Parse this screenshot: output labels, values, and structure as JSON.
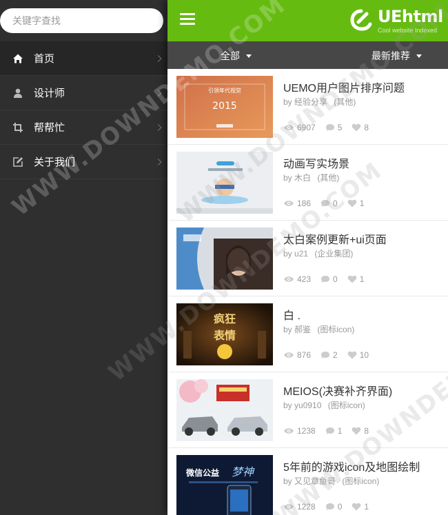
{
  "search": {
    "placeholder": "关键字查找"
  },
  "sidebar": {
    "items": [
      {
        "label": "首页",
        "icon": "home-icon",
        "active": true
      },
      {
        "label": "设计师",
        "icon": "user-icon",
        "active": false
      },
      {
        "label": "帮帮忙",
        "icon": "crop-icon",
        "active": false
      },
      {
        "label": "关于我们",
        "icon": "edit-icon",
        "active": false
      }
    ]
  },
  "header": {
    "logo_text": "UEhtml",
    "logo_sub": "Cool website Indexed",
    "brand_color": "#66bb11"
  },
  "filters": {
    "left": "全部",
    "right": "最新推荐"
  },
  "posts": [
    {
      "title": "UEMO用户图片排序问题",
      "by": "by",
      "author": "经验分享",
      "category": "(其他)",
      "views": "6907",
      "comments": "5",
      "likes": "8"
    },
    {
      "title": "动画写实场景",
      "by": "by",
      "author": "木白",
      "category": "(其他)",
      "views": "186",
      "comments": "0",
      "likes": "1"
    },
    {
      "title": "太白案例更新+ui页面",
      "by": "by",
      "author": "u21",
      "category": "(企业集团)",
      "views": "423",
      "comments": "0",
      "likes": "1"
    },
    {
      "title": "白 .",
      "by": "by",
      "author": "郝鉴",
      "category": "(图标icon)",
      "views": "876",
      "comments": "2",
      "likes": "10"
    },
    {
      "title": "MEIOS(决赛补齐界面)",
      "by": "by",
      "author": "yu0910",
      "category": "(图标icon)",
      "views": "1238",
      "comments": "1",
      "likes": "8"
    },
    {
      "title": "5年前的游戏icon及地图绘制",
      "by": "by",
      "author": "又见章鱼哥",
      "category": "(图标icon)",
      "views": "1228",
      "comments": "0",
      "likes": "1"
    }
  ],
  "watermark": "WWW.DOWNDEMO.COM"
}
